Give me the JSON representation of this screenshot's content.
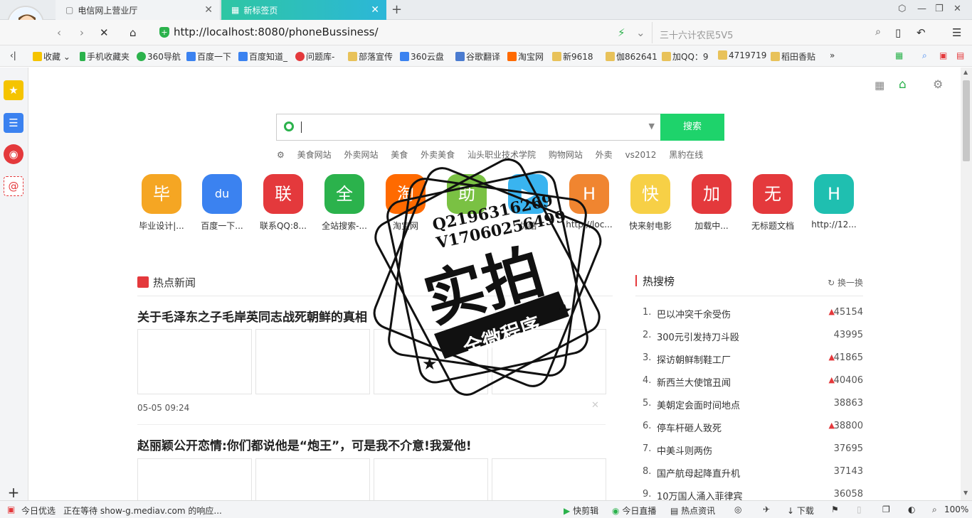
{
  "tabs": [
    {
      "title": "电信网上营业厅"
    },
    {
      "title": "新标签页"
    }
  ],
  "address": {
    "url": "http://localhost:8080/phoneBussiness/",
    "search_text": "三十六计农民5V5"
  },
  "bookmarks": [
    "收藏",
    "手机收藏夹",
    "360导航",
    "百度一下",
    "百度知道_",
    "问题库-",
    "部落宣传",
    "360云盘",
    "谷歌翻译",
    "淘宝网",
    "新9618",
    "伽862641",
    "加QQ：9",
    "4719719",
    "稻田香贴"
  ],
  "search": {
    "button": "搜索"
  },
  "hot_words": [
    "美食网站",
    "外卖网站",
    "美食",
    "外卖美食",
    "汕头职业技术学院",
    "购物网站",
    "外卖",
    "vs2012",
    "黑豹在线"
  ],
  "apps": [
    {
      "icon": "毕",
      "label": "毕业设计|...",
      "color": "#f5a623"
    },
    {
      "icon": "du",
      "label": "百度一下...",
      "color": "#3b82f0"
    },
    {
      "icon": "联",
      "label": "联系QQ:8...",
      "color": "#e4393c"
    },
    {
      "icon": "全",
      "label": "全站搜索-...",
      "color": "#2bb24c"
    },
    {
      "icon": "淘",
      "label": "淘宝网",
      "color": "#ff6a00"
    },
    {
      "icon": "助",
      "label": "",
      "color": "#7ac143"
    },
    {
      "icon": "▶",
      "label": "优酷",
      "color": "#39b4f0"
    },
    {
      "icon": "H",
      "label": "http://loc...",
      "color": "#f08530"
    },
    {
      "icon": "快",
      "label": "快来射电影",
      "color": "#f7d046"
    },
    {
      "icon": "加",
      "label": "加载中...",
      "color": "#e4393c"
    },
    {
      "icon": "无",
      "label": "无标题文档",
      "color": "#e4393c"
    },
    {
      "icon": "H",
      "label": "http://12...",
      "color": "#1fbfb0"
    }
  ],
  "news": {
    "heading": "热点新闻",
    "items": [
      {
        "title": "关于毛泽东之子毛岸英同志战死朝鲜的真相",
        "time": "05-05 09:24"
      },
      {
        "title": "赵丽颖公开恋情:你们都说他是“炮王”，可是我不介意!我爱他!"
      }
    ]
  },
  "hot_list": {
    "heading": "热搜榜",
    "refresh": "换一换",
    "items": [
      {
        "rank": "1.",
        "name": "巴以冲突千余受伤",
        "count": "45154",
        "up": true
      },
      {
        "rank": "2.",
        "name": "300元引发持刀斗殴",
        "count": "43995",
        "up": false
      },
      {
        "rank": "3.",
        "name": "探访朝鲜制鞋工厂",
        "count": "41865",
        "up": true
      },
      {
        "rank": "4.",
        "name": "新西兰大使馆丑闻",
        "count": "40406",
        "up": true
      },
      {
        "rank": "5.",
        "name": "美朝定会面时间地点",
        "count": "38863",
        "up": false
      },
      {
        "rank": "6.",
        "name": "停车杆砸人致死",
        "count": "38800",
        "up": true
      },
      {
        "rank": "7.",
        "name": "中美斗则两伤",
        "count": "37695",
        "up": false
      },
      {
        "rank": "8.",
        "name": "国产航母起降直升机",
        "count": "37143",
        "up": false
      },
      {
        "rank": "9.",
        "name": "10万国人涌入菲律宾",
        "count": "36058",
        "up": false
      }
    ]
  },
  "stamp": {
    "line1": "Q2196316269",
    "line2": "V17060256499",
    "big": "实拍",
    "ribbon": "全微程序"
  },
  "status": {
    "left": "今日优选",
    "loading": "正在等待 show-g.mediav.com 的响应...",
    "right": [
      "快剪辑",
      "今日直播",
      "热点资讯",
      "下载"
    ],
    "zoom": "100%"
  }
}
